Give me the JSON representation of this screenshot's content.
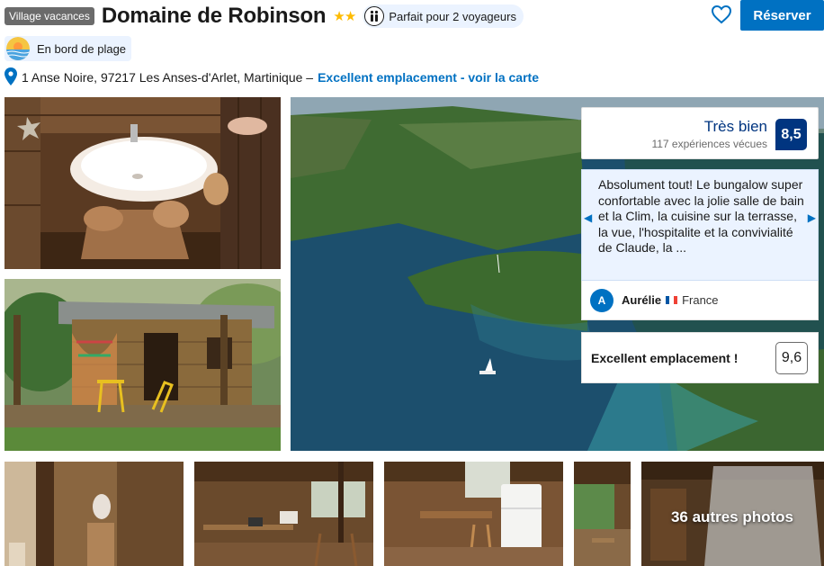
{
  "header": {
    "type_badge": "Village vacances",
    "title": "Domaine de Robinson",
    "stars": "★★",
    "star_count": 2,
    "couple_label": "Parfait pour 2 voyageurs",
    "reserve_label": "Réserver"
  },
  "beach": {
    "label": "En bord de plage"
  },
  "address": {
    "text": "1 Anse Noire, 97217 Les Anses-d'Arlet, Martinique –",
    "map_link": "Excellent emplacement - voir la carte"
  },
  "review": {
    "word": "Très bien",
    "count": "117 expériences vécues",
    "score": "8,5",
    "quote": "Absolument tout! Le bungalow super confortable avec la jolie salle de bain et la Clim, la cuisine sur la terrasse, la vue, l'hospitalite et la convivialité de Claude, la ...",
    "reviewer_initial": "A",
    "reviewer_name": "Aurélie",
    "reviewer_country": "France"
  },
  "location": {
    "label": "Excellent emplacement !",
    "score": "9,6"
  },
  "gallery": {
    "more_photos": "36 autres photos"
  },
  "colors": {
    "accent": "#0071c2",
    "brand_dark": "#003580",
    "star": "#febb02",
    "pill_bg": "#ebf3ff"
  },
  "icons": [
    "heart-icon",
    "couple-icon",
    "beach-icon",
    "pin-icon",
    "chevron-left-icon",
    "chevron-right-icon"
  ]
}
